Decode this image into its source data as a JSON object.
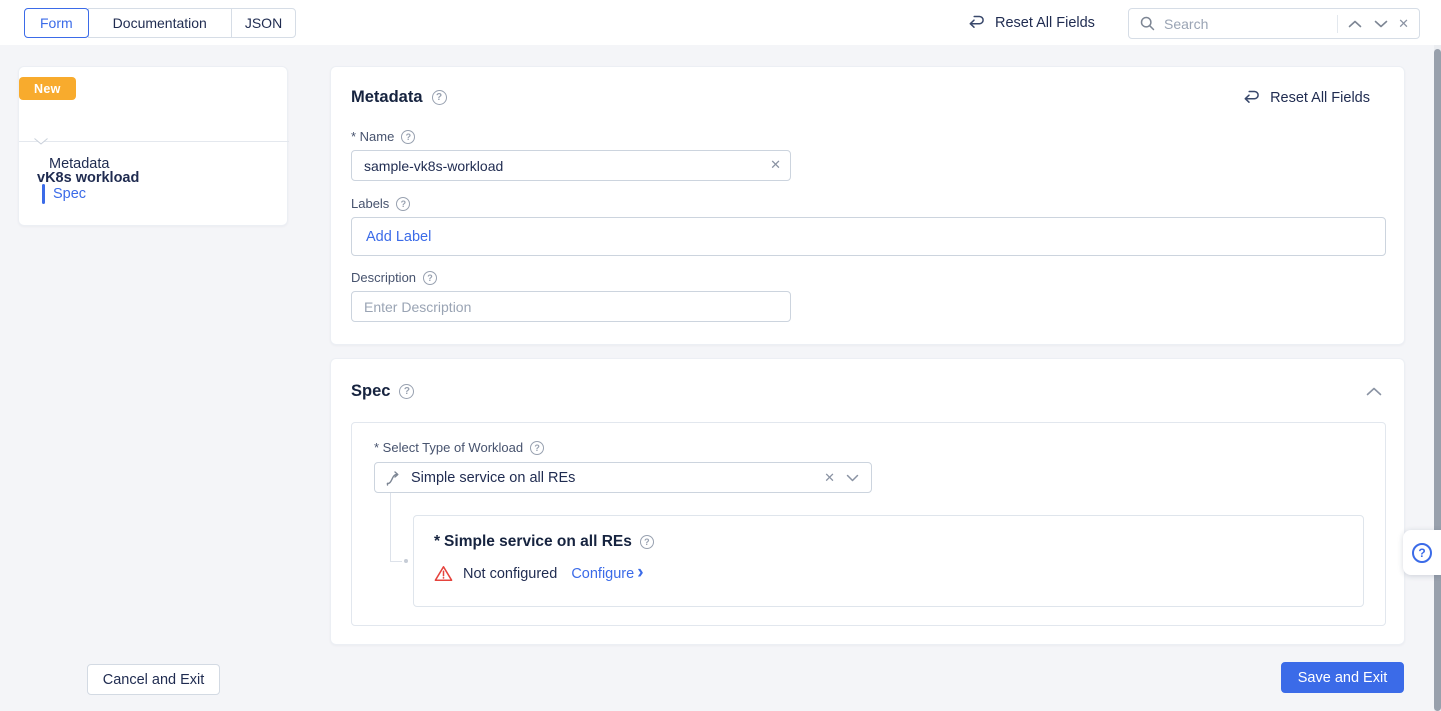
{
  "icons": {
    "help_glyph": "?",
    "close_glyph": "✕",
    "chevron_right_glyph": "›"
  },
  "colors": {
    "accent": "#3b6be8",
    "badge_orange": "#f8ab2d",
    "warning_red": "#e5433d",
    "background": "#f4f5f8"
  },
  "topbar": {
    "tabs": [
      {
        "label": "Form",
        "active": true
      },
      {
        "label": "Documentation",
        "active": false
      },
      {
        "label": "JSON",
        "active": false
      }
    ],
    "reset_label": "Reset All Fields",
    "search_placeholder": "Search"
  },
  "sidebar": {
    "badge": "New",
    "title": "vK8s workload",
    "items": [
      {
        "label": "Metadata",
        "active": false
      },
      {
        "label": "Spec",
        "active": true
      }
    ]
  },
  "metadata_section": {
    "title": "Metadata",
    "reset_label": "Reset All Fields",
    "name_label": "* Name",
    "name_value": "sample-vk8s-workload",
    "labels_label": "Labels",
    "add_label_text": "Add Label",
    "description_label": "Description",
    "description_placeholder": "Enter Description"
  },
  "spec_section": {
    "title": "Spec",
    "type_label": "* Select Type of Workload",
    "type_value": "Simple service on all REs",
    "nested_card": {
      "required_marker": "*",
      "title": "Simple service on all REs",
      "status_text": "Not configured",
      "configure_label": "Configure"
    }
  },
  "footer": {
    "cancel_label": "Cancel and Exit",
    "save_label": "Save and Exit"
  }
}
